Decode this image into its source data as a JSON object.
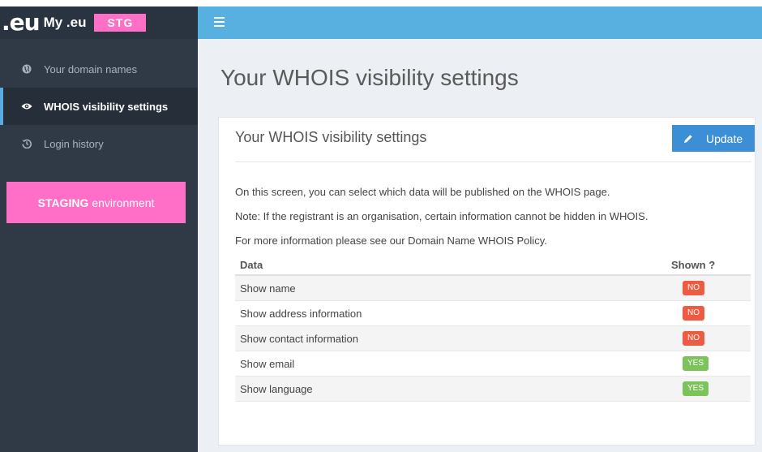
{
  "brand": {
    "logo": ".eu",
    "name": "My .eu",
    "badge": "STG"
  },
  "sidebar": {
    "items": [
      {
        "label": "Your domain names",
        "icon": "globe-icon"
      },
      {
        "label": "WHOIS visibility settings",
        "icon": "eye-icon",
        "active": true
      },
      {
        "label": "Login history",
        "icon": "history-icon"
      }
    ],
    "staging": {
      "bold": "STAGING",
      "rest": "environment"
    }
  },
  "page": {
    "title": "Your WHOIS visibility settings"
  },
  "panel": {
    "title": "Your WHOIS visibility settings",
    "update_label": "Update",
    "info": [
      "On this screen, you can select which data will be published on the WHOIS page.",
      "Note: If the registrant is an organisation, certain information cannot be hidden in WHOIS.",
      "For more information please see our Domain Name WHOIS Policy."
    ]
  },
  "table": {
    "headers": {
      "data": "Data",
      "shown": "Shown ?"
    },
    "rows": [
      {
        "label": "Show name",
        "shown": "NO"
      },
      {
        "label": "Show address information",
        "shown": "NO"
      },
      {
        "label": "Show contact information",
        "shown": "NO"
      },
      {
        "label": "Show email",
        "shown": "YES"
      },
      {
        "label": "Show language",
        "shown": "YES"
      }
    ]
  },
  "colors": {
    "no": "#ee5b43",
    "yes": "#7cc35b",
    "accent": "#57b0e0",
    "staging": "#ff6ec7"
  }
}
